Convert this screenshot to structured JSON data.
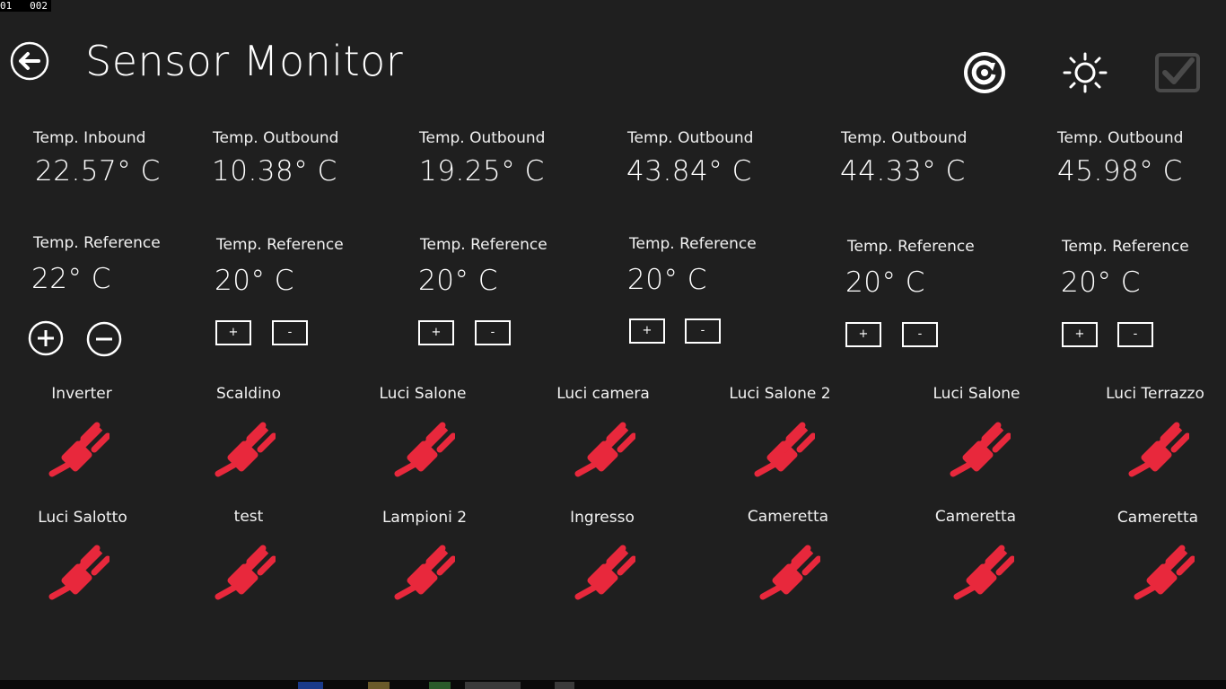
{
  "debug": {
    "counter": "01   002"
  },
  "header": {
    "title": "Sensor Monitor"
  },
  "temps": [
    {
      "label": "Temp. Inbound",
      "value": "22.57° C"
    },
    {
      "label": "Temp. Outbound",
      "value": "10.38° C"
    },
    {
      "label": "Temp. Outbound",
      "value": "19.25° C"
    },
    {
      "label": "Temp. Outbound",
      "value": "43.84° C"
    },
    {
      "label": "Temp. Outbound",
      "value": "44.33° C"
    },
    {
      "label": "Temp. Outbound",
      "value": "45.98° C"
    }
  ],
  "refs": [
    {
      "label": "Temp. Reference",
      "value": "22° C",
      "plus": "+",
      "minus": "-"
    },
    {
      "label": "Temp. Reference",
      "value": "20° C",
      "plus": "+",
      "minus": "-"
    },
    {
      "label": "Temp. Reference",
      "value": "20° C",
      "plus": "+",
      "minus": "-"
    },
    {
      "label": "Temp. Reference",
      "value": "20° C",
      "plus": "+",
      "minus": "-"
    },
    {
      "label": "Temp. Reference",
      "value": "20° C",
      "plus": "+",
      "minus": "-"
    },
    {
      "label": "Temp. Reference",
      "value": "20° C",
      "plus": "+",
      "minus": "-"
    }
  ],
  "devices_row1": [
    {
      "label": "Inverter",
      "icon": "plug-icon"
    },
    {
      "label": "Scaldino",
      "icon": "plug-icon"
    },
    {
      "label": "Luci Salone",
      "icon": "plug-icon"
    },
    {
      "label": "Luci camera",
      "icon": "plug-icon"
    },
    {
      "label": "Luci Salone 2",
      "icon": "plug-icon"
    },
    {
      "label": "Luci Salone",
      "icon": "plug-icon"
    },
    {
      "label": "Luci Terrazzo",
      "icon": "plug-icon"
    }
  ],
  "devices_row2": [
    {
      "label": "Luci Salotto",
      "icon": "plug-icon"
    },
    {
      "label": "test",
      "icon": "plug-icon"
    },
    {
      "label": "Lampioni 2",
      "icon": "plug-icon"
    },
    {
      "label": "Ingresso",
      "icon": "plug-icon"
    },
    {
      "label": "Cameretta",
      "icon": "plug-icon"
    },
    {
      "label": "Cameretta",
      "icon": "plug-icon"
    },
    {
      "label": "Cameretta",
      "icon": "plug-icon"
    }
  ],
  "colors": {
    "background": "#1f1f1f",
    "plug_off": "#e8283c",
    "text": "#ffffff"
  }
}
